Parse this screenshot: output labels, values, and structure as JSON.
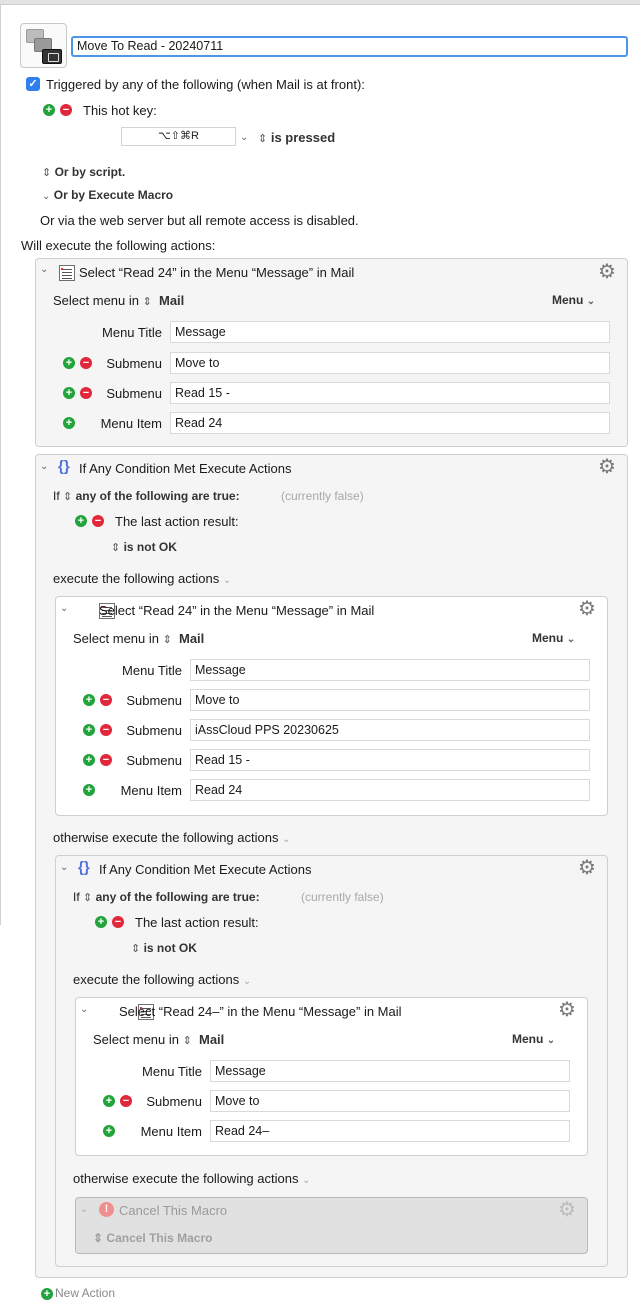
{
  "macro": {
    "name": "Move To Read - 20240711",
    "trigger_label": "Triggered by any of the following (when Mail is at front):",
    "hotkey_label": "This hot key:",
    "hotkey": "⌥⇧⌘R",
    "hotkey_state": "is pressed",
    "or_by_script": "Or by script.",
    "or_by_execute_macro": "Or by Execute Macro",
    "web_server_note": "Or via the web server but all remote access is disabled.",
    "will_execute": "Will execute the following actions:",
    "new_action": "New Action"
  },
  "common": {
    "select_menu_in": "Select menu in",
    "app": "Mail",
    "menu_button": "Menu",
    "menu_title_label": "Menu Title",
    "submenu_label": "Submenu",
    "menu_item_label": "Menu Item",
    "if_label": "If",
    "any_of_following": "any of the following are true:",
    "currently_false": "(currently false)",
    "last_action_result": "The last action result:",
    "is_not_ok": "is not OK",
    "execute_following": "execute the following actions",
    "otherwise_execute": "otherwise execute the following actions"
  },
  "action1": {
    "title": "Select “Read 24” in the Menu “Message” in Mail",
    "menu_title": "Message",
    "submenus": [
      "Move to",
      "Read 15 -"
    ],
    "menu_item": "Read 24"
  },
  "if1": {
    "title": "If Any Condition Met Execute Actions"
  },
  "action2": {
    "title": "Select “Read 24” in the Menu “Message” in Mail",
    "menu_title": "Message",
    "submenus": [
      "Move to",
      "iAssCloud PPS 20230625",
      "Read 15 -"
    ],
    "menu_item": "Read 24"
  },
  "if2": {
    "title": "If Any Condition Met Execute Actions"
  },
  "action3": {
    "title": "Select “Read 24–” in the Menu “Message” in Mail",
    "menu_title": "Message",
    "submenus": [
      "Move to"
    ],
    "menu_item": "Read 24–"
  },
  "cancel": {
    "title": "Cancel This Macro",
    "option": "Cancel This Macro"
  }
}
